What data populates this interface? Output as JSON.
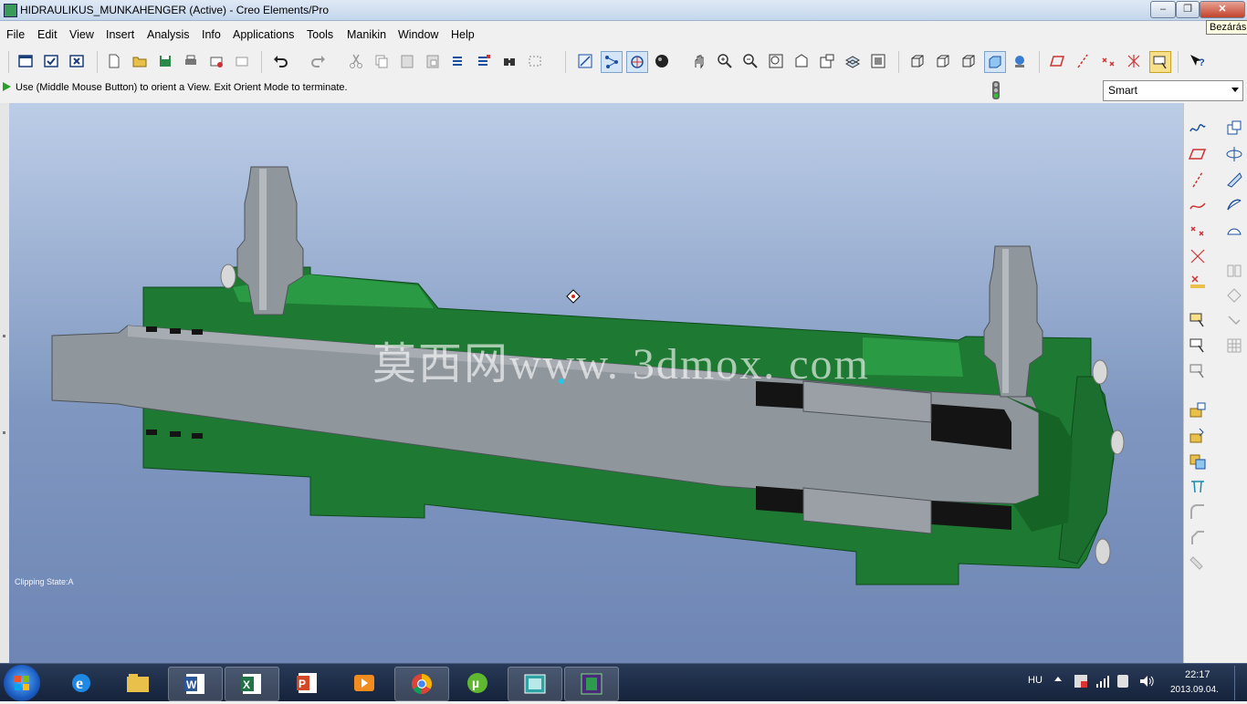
{
  "window": {
    "title": "HIDRAULIKUS_MUNKAHENGER (Active) - Creo Elements/Pro",
    "close_tooltip": "Bezárás"
  },
  "menu": [
    "File",
    "Edit",
    "View",
    "Insert",
    "Analysis",
    "Info",
    "Applications",
    "Tools",
    "Manikin",
    "Window",
    "Help"
  ],
  "status": {
    "message": "Use (Middle Mouse Button) to orient a   View.  Exit Orient Mode to terminate."
  },
  "filter": {
    "selected": "Smart"
  },
  "viewport": {
    "clipping_state": "Clipping State:A",
    "watermark": "莫西网www. 3dmox. com"
  },
  "taskbar": {
    "language": "HU",
    "time": "22:17",
    "date": "2013.09.04."
  },
  "colors": {
    "model_green": "#1e7a32",
    "metal_gray": "#8f969c",
    "seal_black": "#141414"
  }
}
